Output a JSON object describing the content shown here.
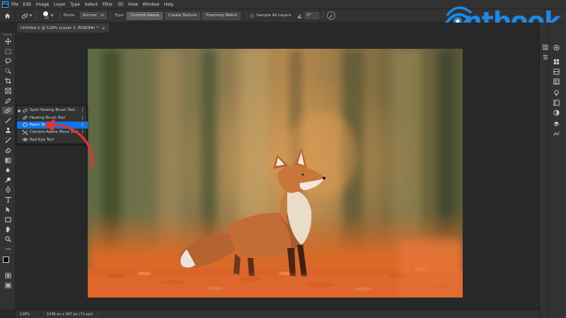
{
  "menu": [
    "File",
    "Edit",
    "Image",
    "Layer",
    "Type",
    "Select",
    "Filter",
    "3D",
    "View",
    "Window",
    "Help"
  ],
  "options_bar": {
    "brush_size": "19",
    "mode_label": "Mode:",
    "mode_value": "Normal",
    "type_label": "Type:",
    "type_buttons": [
      "Content-Aware",
      "Create Texture",
      "Proximity Match"
    ],
    "sample_all_layers": "Sample All Layers",
    "angle_value": "0°"
  },
  "document_tab": {
    "title": "Untitled-1 @ 128% (Layer 1, RGB/8#) *",
    "close": "×"
  },
  "flyout": {
    "items": [
      {
        "label": "Spot Healing Brush Tool",
        "key": "J",
        "icon": "spot-healing-brush-icon",
        "current": true
      },
      {
        "label": "Healing Brush Tool",
        "key": "J",
        "icon": "healing-brush-icon",
        "current": false
      },
      {
        "label": "Patch Tool",
        "key": "J",
        "icon": "patch-icon",
        "current": false
      },
      {
        "label": "Content-Aware Move Tool",
        "key": "J",
        "icon": "content-aware-move-icon",
        "current": false
      },
      {
        "label": "Red Eye Tool",
        "key": "",
        "icon": "red-eye-icon",
        "current": false
      }
    ],
    "highlighted_index": 2
  },
  "status_bar": {
    "zoom": "128%",
    "doc_info": "1046 px x 667 px (72 ppi)"
  },
  "brand": {
    "text": "ntbook",
    "color": "#1e88e5"
  },
  "annotation": {
    "arrow_color": "#e3342f"
  }
}
